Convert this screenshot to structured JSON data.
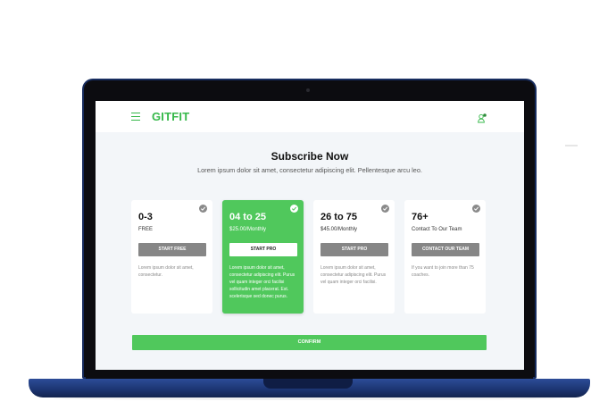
{
  "header": {
    "logo": "GITFIT",
    "menu_icon": "hamburger-menu-icon",
    "user_icon": "user-notification-icon"
  },
  "main": {
    "title": "Subscribe Now",
    "subtitle": "Lorem ipsum dolor sit amet, consectetur adipiscing elit. Pellentesque arcu leo."
  },
  "plans": [
    {
      "name": "0-3",
      "price": "FREE",
      "button": "START FREE",
      "description": "Lorem ipsum dolor sit amet, consectetur.",
      "selected": false
    },
    {
      "name": "04 to 25",
      "price": "$25.00/Monthly",
      "button": "START PRO",
      "description": "Lorem ipsum dolor sit amet, consectetur adipiscing elit. Purus vel quam integer orci facilisi sollicitudin amet placerat. Est. scelerisque sed donec purus.",
      "selected": true
    },
    {
      "name": "26 to 75",
      "price": "$45.00/Monthly",
      "button": "START PRO",
      "description": "Lorem ipsum dolor sit amet, consectetur adipiscing elit. Purus vel quam integer orci facilisi.",
      "selected": false
    },
    {
      "name": "76+",
      "price": "Contact To Our Team",
      "button": "CONTACT OUR TEAM",
      "description": "If you want to join more than 75 coaches.",
      "selected": false
    }
  ],
  "confirm_label": "CONFIRM",
  "colors": {
    "accent": "#50c85c",
    "logo": "#35b849",
    "laptop": "#1d3674",
    "button_gray": "#868686",
    "screen_bg": "#f3f6f9"
  }
}
